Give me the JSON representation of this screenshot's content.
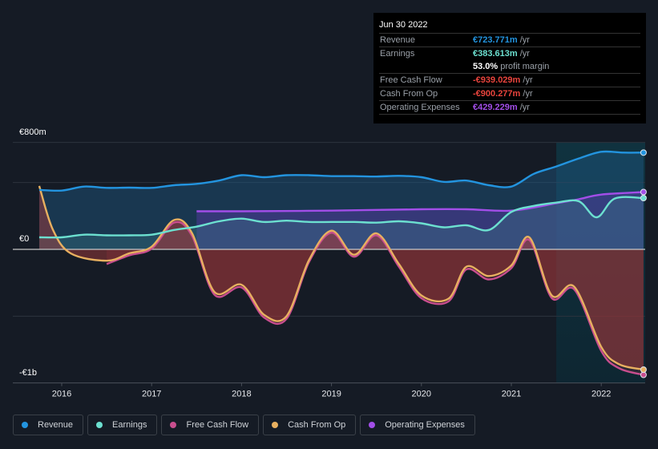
{
  "tooltip": {
    "date": "Jun 30 2022",
    "rows": [
      {
        "label": "Revenue",
        "value": "€723.771m",
        "unit": " /yr",
        "color": "#2394df"
      },
      {
        "label": "Earnings",
        "value": "€383.613m",
        "unit": " /yr",
        "color": "#6ce0d0"
      },
      {
        "label": "",
        "value": "53.0%",
        "unit": " profit margin",
        "color": "#ffffff"
      },
      {
        "label": "Free Cash Flow",
        "value": "-€939.029m",
        "unit": " /yr",
        "color": "#e9443d"
      },
      {
        "label": "Cash From Op",
        "value": "-€900.277m",
        "unit": " /yr",
        "color": "#e9443d"
      },
      {
        "label": "Operating Expenses",
        "value": "€429.229m",
        "unit": " /yr",
        "color": "#a24ee8"
      }
    ]
  },
  "legend": [
    {
      "label": "Revenue",
      "color": "#2394df"
    },
    {
      "label": "Earnings",
      "color": "#6ce0d0"
    },
    {
      "label": "Free Cash Flow",
      "color": "#c84e8e"
    },
    {
      "label": "Cash From Op",
      "color": "#e8b060"
    },
    {
      "label": "Operating Expenses",
      "color": "#a24ee8"
    }
  ],
  "chart_data": {
    "type": "line",
    "title": "",
    "xlabel": "",
    "ylabel": "",
    "ylim": [
      -1000,
      800
    ],
    "xlim": [
      2015.74,
      2022.5
    ],
    "y_ticks": [
      {
        "value": 800,
        "label": "€800m"
      },
      {
        "value": 0,
        "label": "€0"
      },
      {
        "value": -1000,
        "label": "-€1b"
      }
    ],
    "gridlines": [
      800,
      500,
      0,
      -500,
      -1000
    ],
    "x_ticks": [
      {
        "value": 2016,
        "label": "2016"
      },
      {
        "value": 2017,
        "label": "2017"
      },
      {
        "value": 2018,
        "label": "2018"
      },
      {
        "value": 2019,
        "label": "2019"
      },
      {
        "value": 2020,
        "label": "2020"
      },
      {
        "value": 2021,
        "label": "2021"
      },
      {
        "value": 2022,
        "label": "2022"
      }
    ],
    "highlight_from": 2021.5,
    "series": [
      {
        "name": "Revenue",
        "color": "#2394df",
        "x": [
          2015.75,
          2016,
          2016.25,
          2016.5,
          2016.75,
          2017,
          2017.25,
          2017.5,
          2017.75,
          2018,
          2018.25,
          2018.5,
          2018.75,
          2019,
          2019.25,
          2019.5,
          2019.75,
          2020,
          2020.25,
          2020.5,
          2020.75,
          2021,
          2021.25,
          2021.5,
          2021.75,
          2022,
          2022.25,
          2022.47
        ],
        "values": [
          445,
          440,
          470,
          460,
          462,
          460,
          480,
          490,
          515,
          555,
          540,
          555,
          555,
          548,
          548,
          545,
          550,
          540,
          505,
          515,
          480,
          470,
          565,
          620,
          680,
          730,
          724,
          724
        ]
      },
      {
        "name": "Earnings",
        "color": "#6ce0d0",
        "x": [
          2015.75,
          2016,
          2016.25,
          2016.5,
          2016.75,
          2017,
          2017.25,
          2017.5,
          2017.75,
          2018,
          2018.25,
          2018.5,
          2018.75,
          2019,
          2019.25,
          2019.5,
          2019.75,
          2020,
          2020.25,
          2020.5,
          2020.75,
          2021,
          2021.25,
          2021.5,
          2021.75,
          2021.95,
          2022.15,
          2022.47
        ],
        "values": [
          90,
          90,
          110,
          105,
          105,
          110,
          145,
          170,
          210,
          230,
          205,
          215,
          205,
          205,
          205,
          200,
          210,
          195,
          165,
          180,
          145,
          280,
          325,
          350,
          360,
          240,
          380,
          384
        ]
      },
      {
        "name": "Free Cash Flow",
        "color": "#c84e8e",
        "x": [
          2016.5,
          2016.75,
          2017,
          2017.25,
          2017.45,
          2017.7,
          2018,
          2018.25,
          2018.5,
          2018.75,
          2019,
          2019.25,
          2019.5,
          2019.75,
          2020,
          2020.3,
          2020.5,
          2020.75,
          2021,
          2021.2,
          2021.45,
          2021.7,
          2022,
          2022.2,
          2022.47
        ],
        "values": [
          -110,
          -45,
          5,
          200,
          100,
          -340,
          -285,
          -510,
          -520,
          -95,
          125,
          -55,
          105,
          -130,
          -365,
          -390,
          -150,
          -225,
          -140,
          70,
          -365,
          -300,
          -760,
          -890,
          -939
        ]
      },
      {
        "name": "Cash From Op",
        "color": "#e8b060",
        "x": [
          2015.75,
          2015.9,
          2016.1,
          2016.5,
          2016.75,
          2017,
          2017.25,
          2017.45,
          2017.7,
          2018,
          2018.25,
          2018.5,
          2018.75,
          2019,
          2019.25,
          2019.5,
          2019.75,
          2020,
          2020.3,
          2020.5,
          2020.75,
          2021,
          2021.2,
          2021.45,
          2021.7,
          2022,
          2022.2,
          2022.47
        ],
        "values": [
          475,
          150,
          -30,
          -85,
          -30,
          20,
          220,
          120,
          -320,
          -265,
          -490,
          -500,
          -80,
          140,
          -40,
          120,
          -110,
          -345,
          -370,
          -130,
          -200,
          -120,
          90,
          -345,
          -280,
          -730,
          -860,
          -900
        ]
      },
      {
        "name": "Operating Expenses",
        "color": "#a24ee8",
        "x": [
          2017.5,
          2018,
          2019,
          2020,
          2020.5,
          2021,
          2021.5,
          2021.75,
          2022,
          2022.47
        ],
        "values": [
          285,
          285,
          290,
          300,
          300,
          290,
          345,
          375,
          410,
          429
        ]
      }
    ]
  }
}
